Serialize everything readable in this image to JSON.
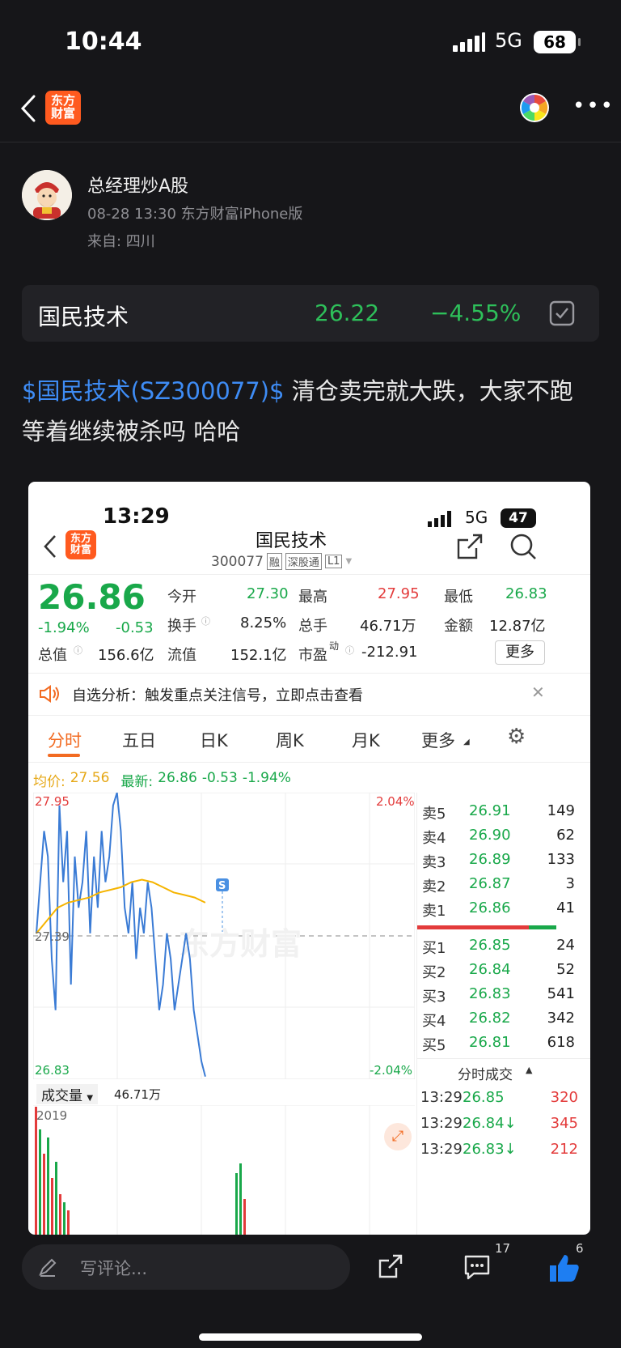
{
  "status_bar": {
    "time": "10:44",
    "network": "5G",
    "battery": "68"
  },
  "top_bar": {
    "app_logo_line1": "东方",
    "app_logo_line2": "财富"
  },
  "post": {
    "author": "总经理炒A股",
    "meta": "08-28 13:30 东方财富iPhone版",
    "location": "来自: 四川",
    "stock_card": {
      "name": "国民技术",
      "price": "26.22",
      "change_pct": "−4.55%"
    },
    "body_tag": "$国民技术(SZ300077)$",
    "body_text_1": " 清仓卖完就大跌，大家不跑",
    "body_text_2": "等着继续被杀吗  哈哈"
  },
  "screenshot": {
    "status": {
      "time": "13:29",
      "network": "5G",
      "battery": "47"
    },
    "header": {
      "title": "国民技术",
      "code": "300077",
      "tag_margin": "融",
      "tag_connect": "深股通",
      "tag_level": "L1",
      "logo_line1": "东方",
      "logo_line2": "财富"
    },
    "quote": {
      "price": "26.86",
      "change_pct": "-1.94%",
      "change": "-0.53",
      "open_label": "今开",
      "open": "27.30",
      "high_label": "最高",
      "high": "27.95",
      "low_label": "最低",
      "low": "26.83",
      "turnover_label": "换手",
      "turnover": "8.25%",
      "volume_label": "总手",
      "volume": "46.71万",
      "amount_label": "金额",
      "amount": "12.87亿",
      "mcap_label": "总值",
      "mcap": "156.6亿",
      "float_label": "流值",
      "float_cap": "152.1亿",
      "pe_label": "市盈",
      "pe_sup": "动",
      "pe": "-212.91",
      "more": "更多"
    },
    "notice": "自选分析：触发重点关注信号，立即点击查看",
    "tabs": [
      "分时",
      "五日",
      "日K",
      "周K",
      "月K",
      "更多"
    ],
    "legend": {
      "avg_label": "均价:",
      "avg": "27.56",
      "last_label": "最新:",
      "last": "26.86",
      "chg": "-0.53",
      "pct": "-1.94%"
    },
    "chart": {
      "y_top": "27.95",
      "y_mid": "27.39",
      "y_bot": "26.83",
      "pct_top": "2.04%",
      "pct_bot": "-2.04%",
      "marker": "S",
      "volume_label": "成交量",
      "volume_value": "46.71万",
      "volume_axis": "2019"
    },
    "order_book": {
      "asks": [
        {
          "label": "卖5",
          "price": "26.91",
          "vol": "149"
        },
        {
          "label": "卖4",
          "price": "26.90",
          "vol": "62"
        },
        {
          "label": "卖3",
          "price": "26.89",
          "vol": "133"
        },
        {
          "label": "卖2",
          "price": "26.87",
          "vol": "3"
        },
        {
          "label": "卖1",
          "price": "26.86",
          "vol": "41"
        }
      ],
      "bids": [
        {
          "label": "买1",
          "price": "26.85",
          "vol": "24"
        },
        {
          "label": "买2",
          "price": "26.84",
          "vol": "52"
        },
        {
          "label": "买3",
          "price": "26.83",
          "vol": "541"
        },
        {
          "label": "买4",
          "price": "26.82",
          "vol": "342"
        },
        {
          "label": "买5",
          "price": "26.81",
          "vol": "618"
        }
      ],
      "ticks_title": "分时成交",
      "ticks": [
        {
          "time": "13:29",
          "price": "26.85",
          "vol": "320"
        },
        {
          "time": "13:29",
          "price": "26.84↓",
          "vol": "345"
        },
        {
          "time": "13:29",
          "price": "26.83↓",
          "vol": "212"
        }
      ]
    }
  },
  "bottom_bar": {
    "comment_placeholder": "写评论...",
    "comment_count": "17",
    "like_count": "6"
  },
  "chart_data": {
    "type": "line",
    "ylim": [
      26.83,
      27.95
    ],
    "series": [
      {
        "values": [
          27.4,
          27.6,
          27.8,
          27.7,
          27.3,
          27.1,
          27.9,
          27.6,
          27.8,
          27.2,
          27.7,
          27.5,
          27.6,
          27.8,
          27.4,
          27.7,
          27.5,
          27.8,
          27.6,
          27.7,
          27.9,
          27.95,
          27.8,
          27.5,
          27.4,
          27.6,
          27.3,
          27.5,
          27.4,
          27.6,
          27.5,
          27.3,
          27.1,
          27.2,
          27.4,
          27.3,
          27.1,
          27.2,
          27.3,
          27.4,
          27.3,
          27.1,
          27.0,
          26.9,
          26.84
        ]
      },
      {
        "values": [
          27.4,
          27.45,
          27.5,
          27.52,
          27.53,
          27.54,
          27.56,
          27.57,
          27.58,
          27.6,
          27.61,
          27.6,
          27.58,
          27.56,
          27.55,
          27.54,
          27.52
        ]
      }
    ]
  }
}
